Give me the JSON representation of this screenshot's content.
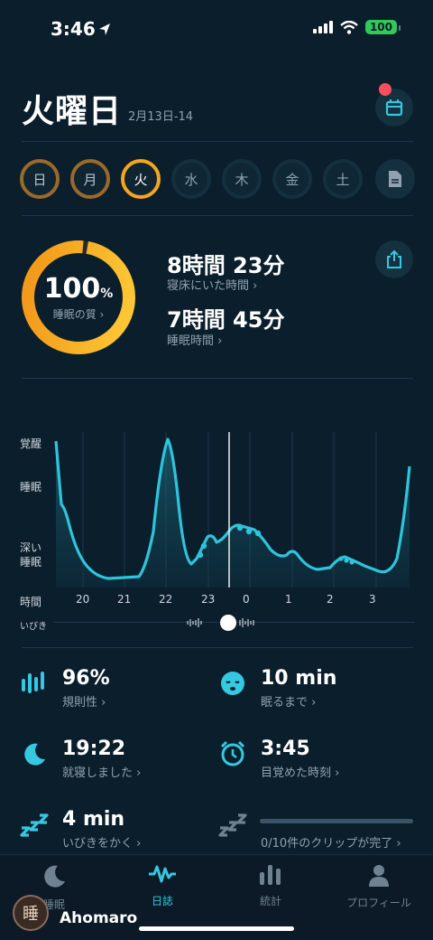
{
  "status_bar": {
    "time": "3:46",
    "battery": "100"
  },
  "header": {
    "title": "火曜日",
    "date_range": "2月13日-14"
  },
  "days": [
    {
      "label": "日",
      "state": "done"
    },
    {
      "label": "月",
      "state": "done"
    },
    {
      "label": "火",
      "state": "active"
    },
    {
      "label": "水",
      "state": "future"
    },
    {
      "label": "木",
      "state": "future"
    },
    {
      "label": "金",
      "state": "future"
    },
    {
      "label": "土",
      "state": "future"
    }
  ],
  "summary": {
    "quality_pct": "100",
    "quality_unit": "%",
    "quality_label": "睡眠の質 ›",
    "quality_fraction": 1.0,
    "time_in_bed": "8時間 23分",
    "time_in_bed_label": "寝床にいた時間 ›",
    "sleep_time": "7時間 45分",
    "sleep_time_label": "睡眠時間 ›"
  },
  "chart": {
    "y_labels": {
      "awake": "覚醒",
      "sleep": "睡眠",
      "deep": "深い\n睡眠"
    },
    "x_title": "時間",
    "snore_label": "いびき",
    "x_ticks": [
      "20",
      "21",
      "22",
      "23",
      "0",
      "1",
      "2",
      "3"
    ]
  },
  "metrics": [
    {
      "icon": "bars-icon",
      "value": "96%",
      "label": "規則性 ›"
    },
    {
      "icon": "sleepy-face-icon",
      "value": "10 min",
      "label": "眠るまで ›"
    },
    {
      "icon": "moon-icon",
      "value": "19:22",
      "label": "就寝しました ›"
    },
    {
      "icon": "alarm-icon",
      "value": "3:45",
      "label": "目覚めた時刻 ›"
    },
    {
      "icon": "zzz-icon",
      "value": "4 min",
      "label": "いびきをかく ›"
    },
    {
      "icon": "zzz-icon",
      "value": "",
      "label": "0/10件のクリップが完了 ›"
    }
  ],
  "tabs": [
    {
      "icon": "moon-icon",
      "label": "睡眠"
    },
    {
      "icon": "wave-icon",
      "label": "日誌"
    },
    {
      "icon": "chart-icon",
      "label": "統計"
    },
    {
      "icon": "person-icon",
      "label": "プロフィール"
    }
  ],
  "watermark": {
    "text": "Ahomaro",
    "logo_char": "睡"
  },
  "colors": {
    "accent": "#35c8e0",
    "orange": "#f7a51e",
    "background": "#0b1e2c"
  }
}
